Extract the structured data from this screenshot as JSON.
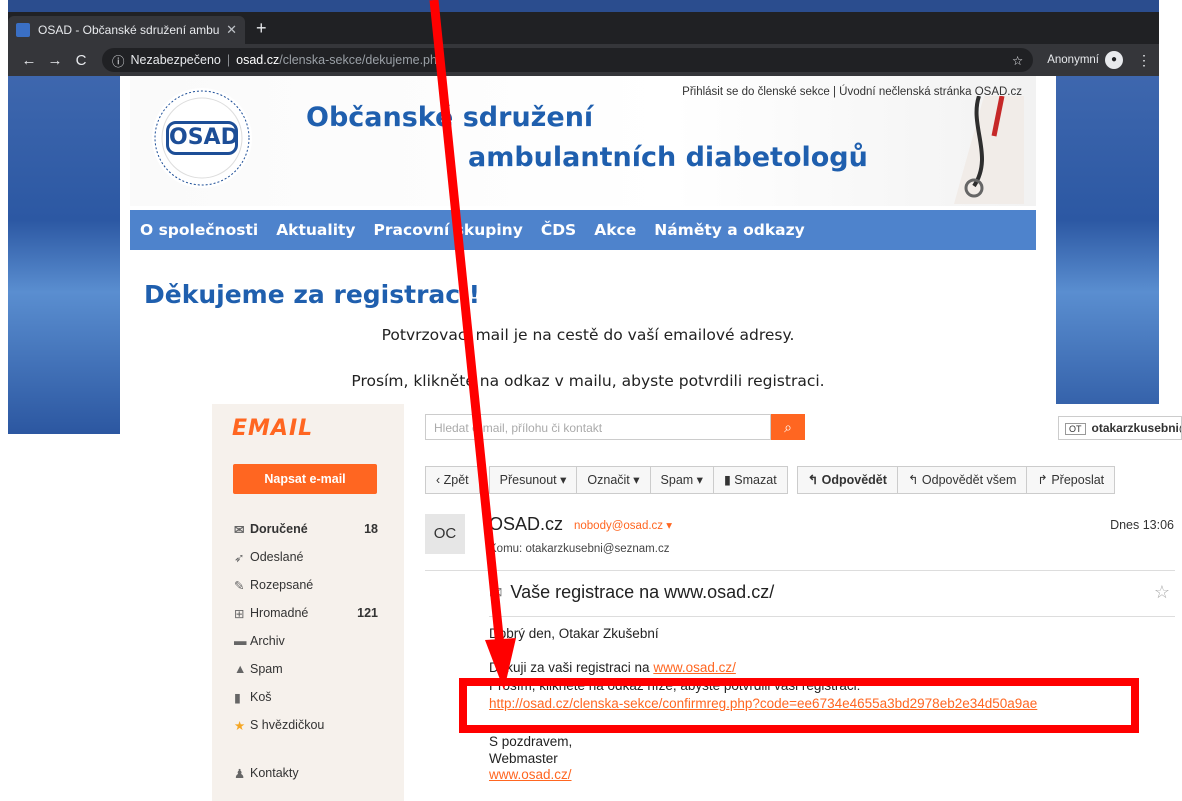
{
  "browser": {
    "tab_title": "OSAD - Občanské sdružení ambu",
    "not_secure": "Nezabezpečeno",
    "url_host": "osad.cz",
    "url_path": "/clenska-sekce/dekujeme.php",
    "incognito_label": "Anonymní"
  },
  "site": {
    "top_links": "Přihlásit se do členské sekce | Úvodní nečlenská stránka OSAD.cz",
    "logo_text": "OSAD",
    "title_line1": "Občanské sdružení",
    "title_line2": "ambulantních diabetologů",
    "nav": [
      "O společnosti",
      "Aktuality",
      "Pracovní skupiny",
      "ČDS",
      "Akce",
      "Náměty a odkazy"
    ],
    "heading": "Děkujeme za registraci!",
    "para1": "Potvrzovací mail je na cestě do vaší emailové adresy.",
    "para2": "Prosím, klikněte na odkaz v mailu, abyste potvrdili registraci."
  },
  "email": {
    "logo": "EMAIL",
    "compose": "Napsat e-mail",
    "search_placeholder": "Hledat e-mail, přílohu či kontakt",
    "user": "otakarzkusebni@",
    "user_badge": "OT",
    "folders": [
      {
        "label": "Doručené",
        "count": "18",
        "icon": "envelope-icon"
      },
      {
        "label": "Odeslané",
        "count": "",
        "icon": "send-icon"
      },
      {
        "label": "Rozepsané",
        "count": "",
        "icon": "draft-icon"
      },
      {
        "label": "Hromadné",
        "count": "121",
        "icon": "cart-icon"
      },
      {
        "label": "Archiv",
        "count": "",
        "icon": "archive-icon"
      },
      {
        "label": "Spam",
        "count": "",
        "icon": "warning-icon"
      },
      {
        "label": "Koš",
        "count": "",
        "icon": "trash-icon"
      },
      {
        "label": "S hvězdičkou",
        "count": "",
        "icon": "star-icon"
      }
    ],
    "contacts": "Kontakty",
    "toolbar": {
      "back": "Zpět",
      "move": "Přesunout",
      "mark": "Označit",
      "spam": "Spam",
      "delete": "Smazat",
      "reply": "Odpovědět",
      "reply_all": "Odpovědět všem",
      "forward": "Přeposlat"
    },
    "message": {
      "avatar": "OC",
      "from_name": "OSAD.cz",
      "from_addr": "nobody@osad.cz",
      "to_label": "Komu:",
      "to": "otakarzkusebni@seznam.cz",
      "date": "Dnes 13:06",
      "subject": "Vaše registrace na www.osad.cz/",
      "greeting": "Dobrý den, Otakar Zkušební",
      "line1_text": "Děkuji za vaši registraci na ",
      "line1_link": "www.osad.cz/",
      "line2": "Prosím, klikněte na odkaz níže, abyste potvrdili vaši registraci:",
      "confirm_link": "http://osad.cz/clenska-sekce/confirmreg.php?code=ee6734e4655a3bd2978eb2e34d50a9ae",
      "sign1": "S pozdravem,",
      "sign2": "Webmaster",
      "sign_link": "www.osad.cz/"
    }
  },
  "colors": {
    "annotation_red": "#ff0000",
    "email_accent": "#ff6621",
    "site_blue": "#1f5fae"
  }
}
